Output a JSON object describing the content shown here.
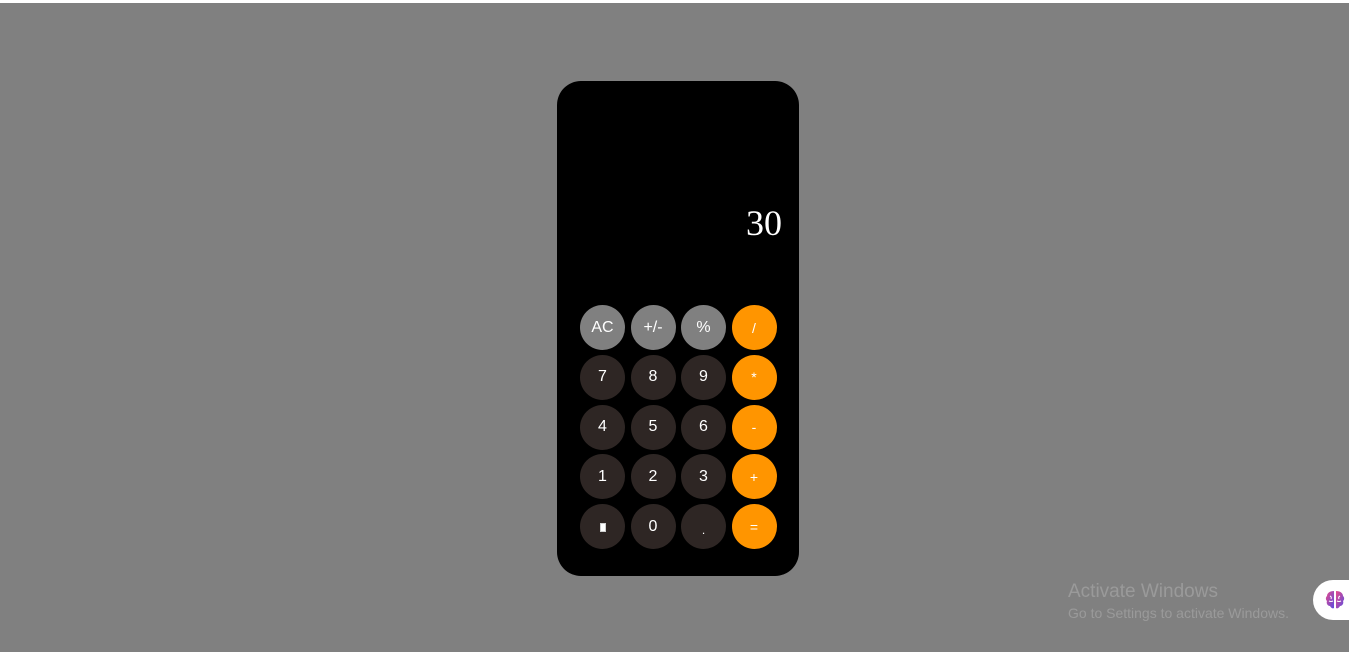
{
  "display": {
    "value": "30"
  },
  "keypad": {
    "rows": [
      [
        {
          "label": "AC",
          "name": "all-clear-button",
          "kind": "fn"
        },
        {
          "label": "+/-",
          "name": "toggle-sign-button",
          "kind": "fn"
        },
        {
          "label": "%",
          "name": "percent-button",
          "kind": "fn"
        },
        {
          "label": "/",
          "name": "divide-button",
          "kind": "op"
        }
      ],
      [
        {
          "label": "7",
          "name": "digit-7-button",
          "kind": "num"
        },
        {
          "label": "8",
          "name": "digit-8-button",
          "kind": "num"
        },
        {
          "label": "9",
          "name": "digit-9-button",
          "kind": "num"
        },
        {
          "label": "*",
          "name": "multiply-button",
          "kind": "op"
        }
      ],
      [
        {
          "label": "4",
          "name": "digit-4-button",
          "kind": "num"
        },
        {
          "label": "5",
          "name": "digit-5-button",
          "kind": "num"
        },
        {
          "label": "6",
          "name": "digit-6-button",
          "kind": "num"
        },
        {
          "label": "-",
          "name": "subtract-button",
          "kind": "op"
        }
      ],
      [
        {
          "label": "1",
          "name": "digit-1-button",
          "kind": "num"
        },
        {
          "label": "2",
          "name": "digit-2-button",
          "kind": "num"
        },
        {
          "label": "3",
          "name": "digit-3-button",
          "kind": "num"
        },
        {
          "label": "+",
          "name": "add-button",
          "kind": "op"
        }
      ],
      [
        {
          "label": "",
          "name": "delete-button",
          "kind": "num",
          "icon": "delete-icon"
        },
        {
          "label": "0",
          "name": "digit-0-button",
          "kind": "num"
        },
        {
          "label": ".",
          "name": "decimal-button",
          "kind": "num"
        },
        {
          "label": "=",
          "name": "equals-button",
          "kind": "op"
        }
      ]
    ]
  },
  "watermark": {
    "title": "Activate Windows",
    "subtitle": "Go to Settings to activate Windows."
  },
  "extension": {
    "icon": "brain-icon"
  },
  "colors": {
    "page_background": "#808080",
    "calculator_body": "#000000",
    "function_key": "#808080",
    "number_key": "#2e2624",
    "operator_key": "#ff9500",
    "text": "#ffffff"
  }
}
